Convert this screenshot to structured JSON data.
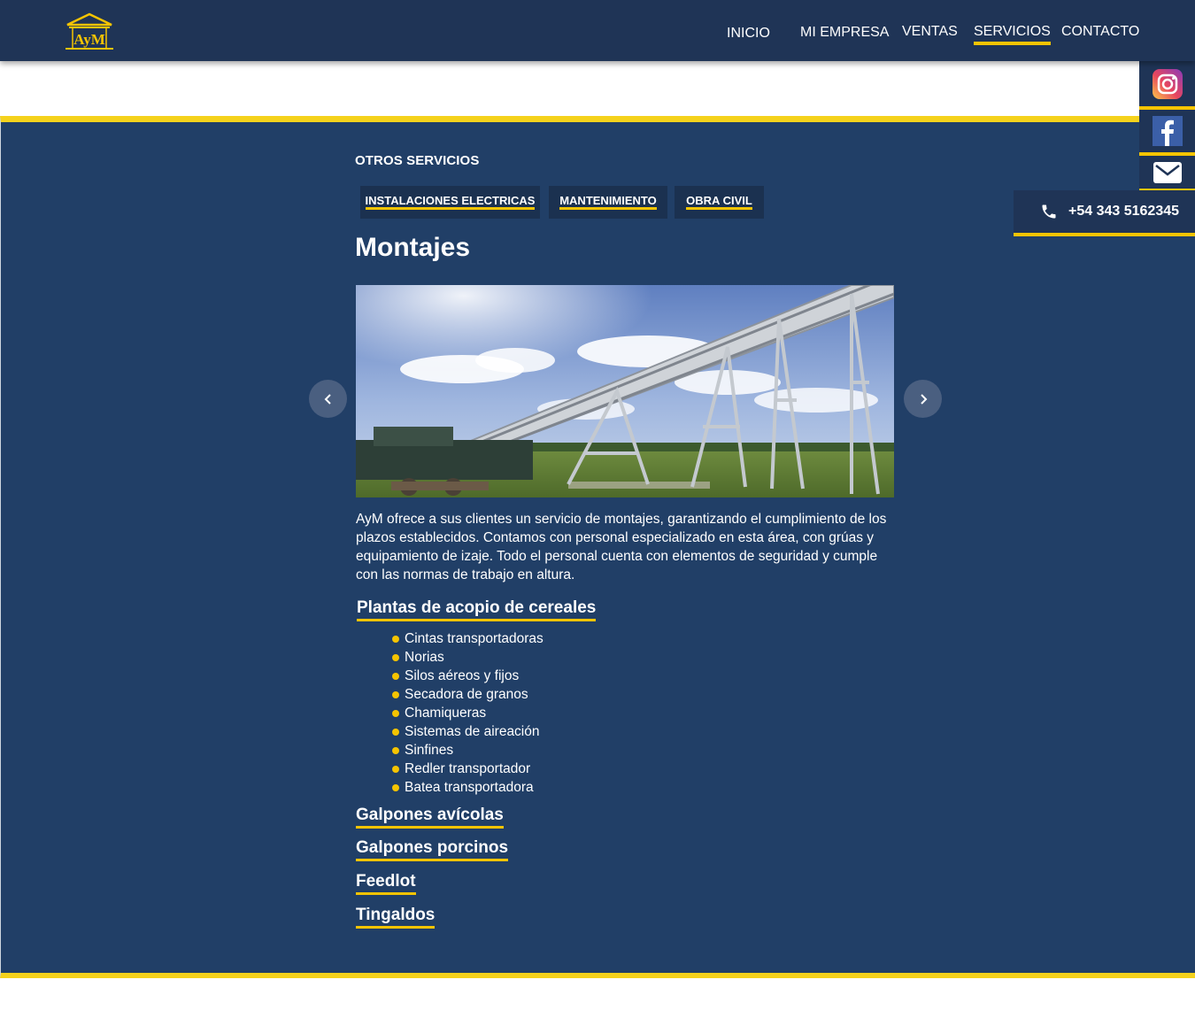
{
  "brand": {
    "logo_text": "AyM",
    "accent": "#f5c400",
    "navy": "#1f3456",
    "body_blue": "#213f67"
  },
  "nav": {
    "items": [
      {
        "label": "INICIO",
        "active": false
      },
      {
        "label": "MI EMPRESA",
        "active": false
      },
      {
        "label": "VENTAS",
        "active": false
      },
      {
        "label": "SERVICIOS",
        "active": true
      },
      {
        "label": "CONTACTO",
        "active": false
      }
    ]
  },
  "contact": {
    "social": [
      "instagram-icon",
      "facebook-icon",
      "mail-icon"
    ],
    "phone": "+54 343 5162345"
  },
  "services": {
    "section_title": "OTROS SERVICIOS",
    "tabs": [
      "INSTALACIONES ELECTRICAS",
      "MANTENIMIENTO",
      "OBRA CIVIL"
    ],
    "heading": "Montajes",
    "description": "AyM ofrece a sus clientes un servicio de montajes, garantizando el cumplimiento de los plazos establecidos. Contamos con personal especializado en esta área, con grúas y equipamiento de izaje. Todo el personal cuenta con elementos de seguridad y cumple con las normas de trabajo en altura.",
    "categories": [
      {
        "title": "Plantas de acopio de cereales",
        "items": [
          "Cintas transportadoras",
          "Norias",
          "Silos aéreos y fijos",
          "Secadora de granos",
          "Chamiqueras",
          "Sistemas de aireación",
          "Sinfines",
          "Redler transportador",
          "Batea transportadora"
        ]
      },
      {
        "title": "Galpones avícolas"
      },
      {
        "title": "Galpones porcinos"
      },
      {
        "title": "Feedlot"
      },
      {
        "title": "Tingaldos"
      }
    ]
  }
}
